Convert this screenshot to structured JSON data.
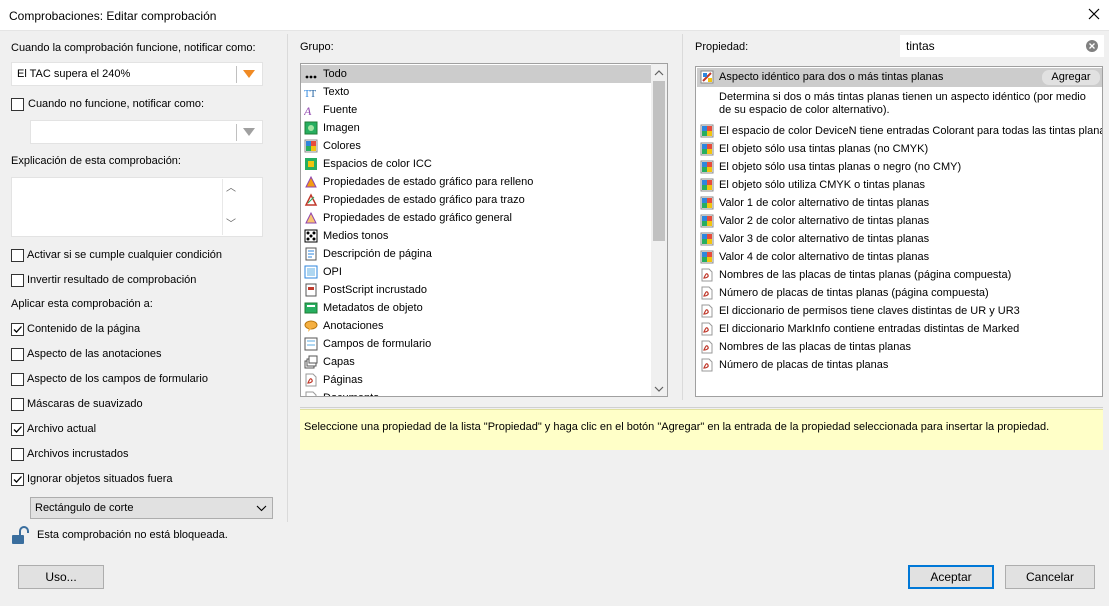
{
  "window": {
    "title": "Comprobaciones: Editar comprobación"
  },
  "left": {
    "notify_label": "Cuando la comprobación funcione, notificar como:",
    "notify_value": "El TAC supera el 240%",
    "not_work_checkbox": {
      "label": "Cuando no funcione, notificar como:",
      "checked": false
    },
    "not_work_value": "",
    "explanation_label": "Explicación de esta comprobación:",
    "explanation_value": "",
    "options": [
      {
        "label": "Activar si se cumple cualquier condición",
        "checked": false
      },
      {
        "label": "Invertir resultado de comprobación",
        "checked": false
      }
    ],
    "apply_label": "Aplicar esta comprobación a:",
    "apply_items": [
      {
        "label": "Contenido de la página",
        "checked": true
      },
      {
        "label": "Aspecto de las anotaciones",
        "checked": false
      },
      {
        "label": "Aspecto de los campos de formulario",
        "checked": false
      },
      {
        "label": "Máscaras de suavizado",
        "checked": false
      },
      {
        "label": "Archivo actual",
        "checked": true
      },
      {
        "label": "Archivos incrustados",
        "checked": false
      },
      {
        "label": "Ignorar objetos situados fuera",
        "checked": true
      }
    ],
    "outside_select": "Rectángulo de corte",
    "lock_text": "Esta comprobación no está bloqueada."
  },
  "group": {
    "label": "Grupo:",
    "items": [
      {
        "label": "Todo",
        "icon": "dots-icon",
        "selected": true
      },
      {
        "label": "Texto",
        "icon": "text-icon"
      },
      {
        "label": "Fuente",
        "icon": "font-icon"
      },
      {
        "label": "Imagen",
        "icon": "image-icon"
      },
      {
        "label": "Colores",
        "icon": "colors-icon"
      },
      {
        "label": "Espacios de color ICC",
        "icon": "icc-icon"
      },
      {
        "label": "Propiedades de estado gráfico para relleno",
        "icon": "fill-icon"
      },
      {
        "label": "Propiedades de estado gráfico para trazo",
        "icon": "stroke-icon"
      },
      {
        "label": "Propiedades de estado gráfico general",
        "icon": "graphic-state-icon"
      },
      {
        "label": "Medios tonos",
        "icon": "halftone-icon"
      },
      {
        "label": "Descripción de página",
        "icon": "page-desc-icon"
      },
      {
        "label": "OPI",
        "icon": "opi-icon"
      },
      {
        "label": "PostScript incrustado",
        "icon": "postscript-icon"
      },
      {
        "label": "Metadatos de objeto",
        "icon": "metadata-icon"
      },
      {
        "label": "Anotaciones",
        "icon": "annotation-icon"
      },
      {
        "label": "Campos de formulario",
        "icon": "form-icon"
      },
      {
        "label": "Capas",
        "icon": "layers-icon"
      },
      {
        "label": "Páginas",
        "icon": "pdf-icon"
      },
      {
        "label": "Documento",
        "icon": "pdf-icon"
      }
    ]
  },
  "property": {
    "label": "Propiedad:",
    "search_value": "tintas",
    "selected": {
      "label": "Aspecto idéntico para dos o más tintas planas",
      "add_button": "Agregar",
      "description": "Determina si dos o más tintas planas tienen un aspecto idéntico (por medio de su espacio de color alternativo)."
    },
    "items": [
      {
        "label": "El espacio de color DeviceN tiene entradas Colorant para todas las tintas planas",
        "icon": "colors-icon"
      },
      {
        "label": "El objeto sólo usa tintas planas (no CMYK)",
        "icon": "colors-icon"
      },
      {
        "label": "El objeto sólo usa tintas planas o negro (no CMY)",
        "icon": "colors-icon"
      },
      {
        "label": "El objeto sólo utiliza CMYK o tintas planas",
        "icon": "colors-icon"
      },
      {
        "label": "Valor 1 de color alternativo de tintas planas",
        "icon": "colors-icon"
      },
      {
        "label": "Valor 2 de color alternativo de tintas planas",
        "icon": "colors-icon"
      },
      {
        "label": "Valor 3 de color alternativo de tintas planas",
        "icon": "colors-icon"
      },
      {
        "label": "Valor 4 de color alternativo de tintas planas",
        "icon": "colors-icon"
      },
      {
        "label": "Nombres de las placas de tintas planas (página compuesta)",
        "icon": "pdf-icon"
      },
      {
        "label": "Número de placas de tintas planas (página compuesta)",
        "icon": "pdf-icon"
      },
      {
        "label": "El diccionario de permisos tiene claves distintas de UR y UR3",
        "icon": "pdf-icon"
      },
      {
        "label": "El diccionario MarkInfo contiene entradas distintas de Marked",
        "icon": "pdf-icon"
      },
      {
        "label": "Nombres de las placas de tintas planas",
        "icon": "pdf-icon"
      },
      {
        "label": "Número de placas de tintas planas",
        "icon": "pdf-icon"
      }
    ]
  },
  "hint": "Seleccione una propiedad de la lista \"Propiedad\" y haga clic en el botón \"Agregar\" en la entrada de la propiedad seleccionada para insertar la propiedad.",
  "buttons": {
    "use": "Uso...",
    "accept": "Aceptar",
    "cancel": "Cancelar"
  },
  "colors": {
    "hint_bg": "#ffffc8",
    "selected_bg": "#cccccc",
    "accent": "#0078d7"
  }
}
